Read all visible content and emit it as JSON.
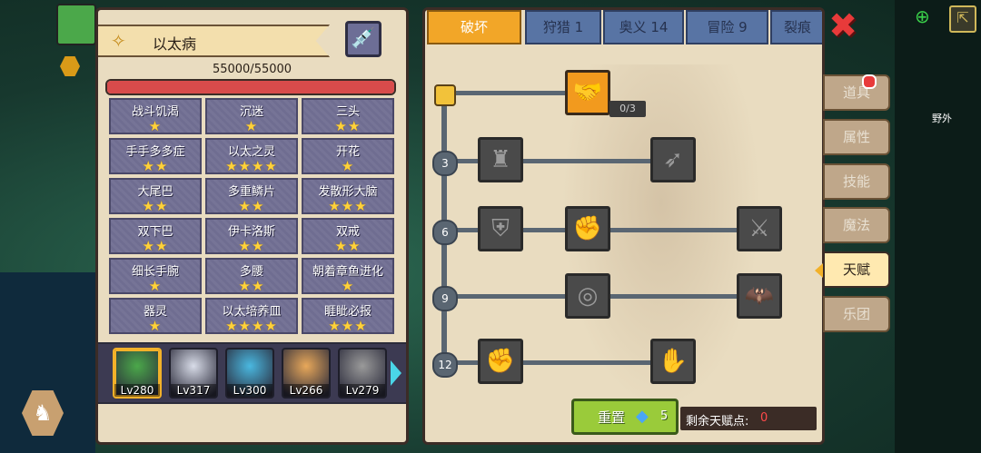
{
  "panel": {
    "title": "以太病",
    "hp_text": "55000/55000",
    "hp_fraction": 1.0
  },
  "skills": [
    {
      "name": "战斗饥渴",
      "stars": "★"
    },
    {
      "name": "沉迷",
      "stars": "★"
    },
    {
      "name": "三头",
      "stars": "★★"
    },
    {
      "name": "手手多多症",
      "stars": "★★"
    },
    {
      "name": "以太之灵",
      "stars": "★★★★"
    },
    {
      "name": "开花",
      "stars": "★"
    },
    {
      "name": "大尾巴",
      "stars": "★★"
    },
    {
      "name": "多重鳞片",
      "stars": "★★"
    },
    {
      "name": "发散形大脑",
      "stars": "★★★"
    },
    {
      "name": "双下巴",
      "stars": "★★"
    },
    {
      "name": "伊卡洛斯",
      "stars": "★★"
    },
    {
      "name": "双戒",
      "stars": "★★"
    },
    {
      "name": "细长手腕",
      "stars": "★"
    },
    {
      "name": "多腰",
      "stars": "★★"
    },
    {
      "name": "朝着章鱼进化",
      "stars": "★"
    },
    {
      "name": "器灵",
      "stars": "★"
    },
    {
      "name": "以太培养皿",
      "stars": "★★★★"
    },
    {
      "name": "睚眦必报",
      "stars": "★★★"
    }
  ],
  "heroes": [
    {
      "level": "Lv280",
      "color": "#4ba84a",
      "active": true
    },
    {
      "level": "Lv317",
      "color": "#d8dce8",
      "active": false
    },
    {
      "level": "Lv300",
      "color": "#4ab8e0",
      "active": false
    },
    {
      "level": "Lv266",
      "color": "#e8a85a",
      "active": false
    },
    {
      "level": "Lv279",
      "color": "#9a9a9a",
      "active": false
    }
  ],
  "tabs": [
    {
      "label": "破坏",
      "active": true
    },
    {
      "label": "狩猎 1",
      "active": false
    },
    {
      "label": "奥义 14",
      "active": false
    },
    {
      "label": "冒险 9",
      "active": false
    },
    {
      "label": "裂痕",
      "active": false
    }
  ],
  "tree": {
    "levels": [
      "3",
      "6",
      "9",
      "12"
    ],
    "node_count": "0/3"
  },
  "reset": {
    "label": "重置",
    "cost": "5"
  },
  "points": {
    "label": "剩余天赋点:",
    "value": "0"
  },
  "side_menu": [
    {
      "label": "道具",
      "active": false
    },
    {
      "label": "属性",
      "active": false
    },
    {
      "label": "技能",
      "active": false
    },
    {
      "label": "魔法",
      "active": false
    },
    {
      "label": "天赋",
      "active": true
    },
    {
      "label": "乐团",
      "active": false
    }
  ],
  "hud": {
    "wild_label": "野外"
  },
  "colors": {
    "accent": "#f2a628",
    "tab_blue": "#5874a4",
    "hp_red": "#d84b4b",
    "reset_green": "#9acb3a"
  }
}
